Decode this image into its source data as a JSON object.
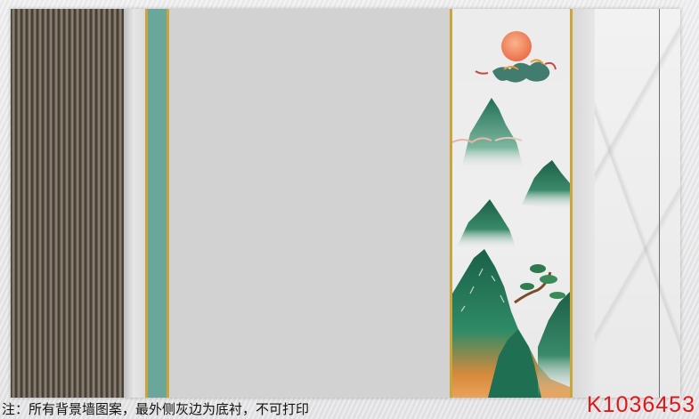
{
  "footer": {
    "note": "注：所有背景墙图案，最外侧灰边为底衬，不可打印",
    "code": "K1036453"
  },
  "colors": {
    "gold_trim": "#c9a53a",
    "teal_strip": "#6aa79a",
    "center_panel": "#d2d2d2",
    "code_red": "#e01818",
    "sun": "#f08a5d"
  },
  "artwork": {
    "left_panel": "dark-wood-slat-panel",
    "mural_subject": "mountain-landscape-with-sun-and-clouds",
    "right_panel": "white-marble-panel"
  }
}
